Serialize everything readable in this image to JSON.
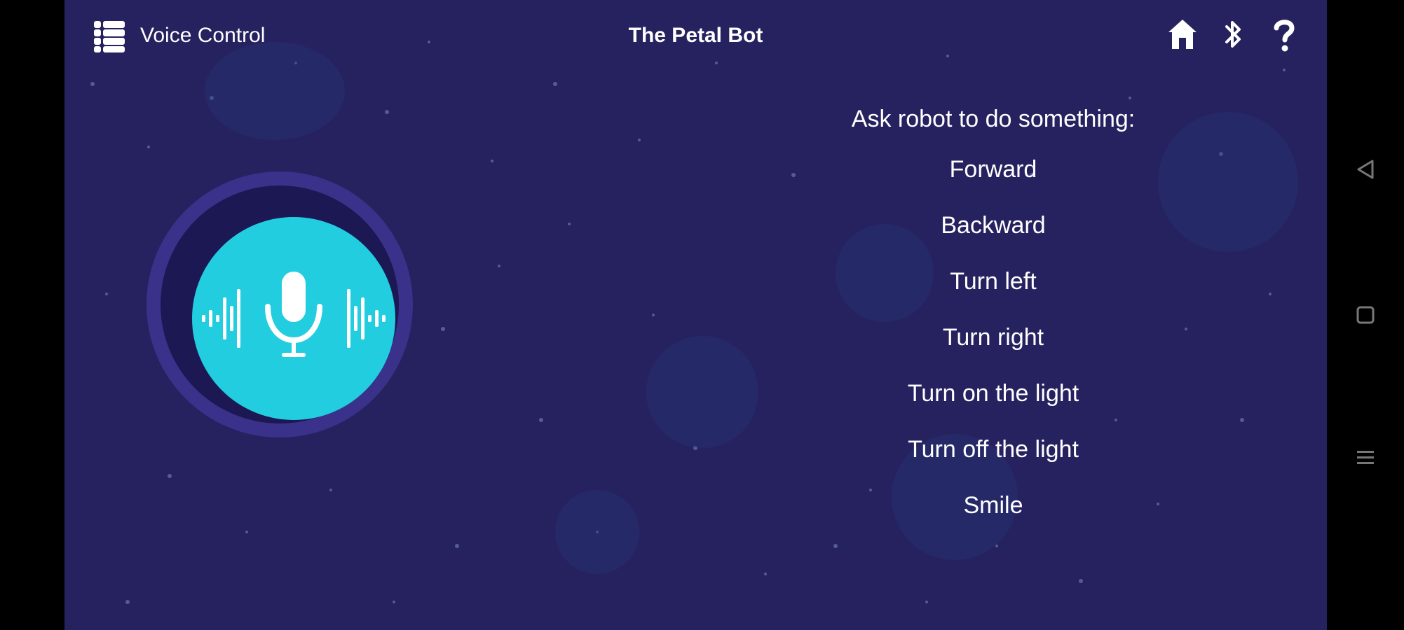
{
  "header": {
    "section_label": "Voice Control",
    "title": "The Petal Bot",
    "menu_icon": "menu-icon",
    "home_icon": "home-icon",
    "bluetooth_icon": "bluetooth-icon",
    "help_icon": "help-icon"
  },
  "mic": {
    "icon": "microphone-icon"
  },
  "commands": {
    "heading": "Ask robot to do something:",
    "items": [
      "Forward",
      "Backward",
      "Turn left",
      "Turn right",
      "Turn on the light",
      "Turn off the light",
      "Smile"
    ]
  },
  "colors": {
    "background": "#26225f",
    "mic_accent": "#22cde0",
    "mic_ring": "#3a318a"
  },
  "system_nav": [
    "back-icon",
    "home-square-icon",
    "recents-icon"
  ]
}
